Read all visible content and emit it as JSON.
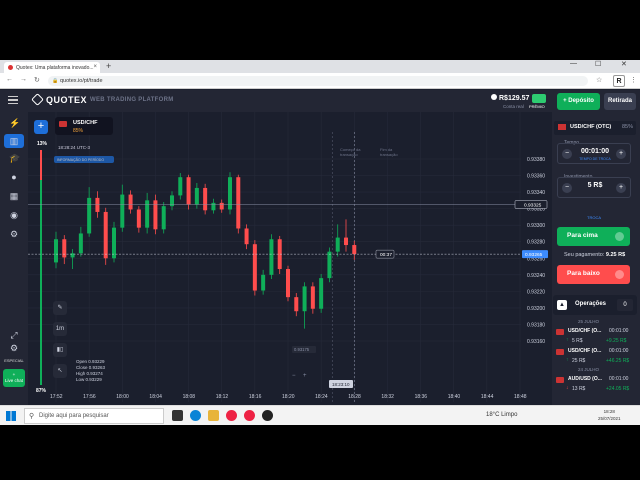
{
  "browser": {
    "tab_title": "Quotex: Uma plataforma inovado...",
    "url": "quotex.io/pt/trade",
    "profile_initial": "R"
  },
  "app": {
    "brand": "QUOTEX",
    "platform_label": "WEB TRADING PLATFORM",
    "balance": "R$129.57",
    "account_type": "Conta real",
    "gift_label": "PRÊMIO",
    "deposit_label": "Depósito",
    "withdraw_label": "Retirada"
  },
  "left_nav": {
    "icons": [
      "menu-icon",
      "lightning-icon",
      "chart-icon",
      "graduation-cap-icon",
      "user-icon",
      "building-icon",
      "signal-icon",
      "settings-icon"
    ],
    "special_label": "ESPECIAL",
    "live_chat_label": "Live chat"
  },
  "chart": {
    "asset": "USD/CHF",
    "asset_payout": "85%",
    "top_percent": "13%",
    "bottom_percent": "87%",
    "clock": "18:28:24",
    "utc": "UTC-3",
    "info_label": "INFORMAÇÃO DO PERÍODO",
    "marker_start_label": "Começo da transação",
    "marker_end_label": "Fim da transação",
    "cursor_price": "0.93325",
    "current_price": "0.93265",
    "timer": "00:37",
    "crosshair_price": "0.93175",
    "crosshair_time": "18:23:10",
    "ohlc": {
      "open": "0.93229",
      "close": "0.93263",
      "high": "0.93274",
      "low": "0.93229"
    },
    "tools": [
      "pencil-icon",
      "1m",
      "candles-icon",
      "cursor-icon"
    ],
    "colors": {
      "up": "#0faf59",
      "down": "#ff4d4d",
      "accent": "#1e6fd9"
    }
  },
  "chart_data": {
    "type": "candlestick",
    "y_ticks": [
      "0.93380",
      "0.93360",
      "0.93340",
      "0.93320",
      "0.93300",
      "0.93280",
      "0.93260",
      "0.93240",
      "0.93220",
      "0.93200",
      "0.93180",
      "0.93160"
    ],
    "x_ticks": [
      "17:52",
      "17:56",
      "18:00",
      "18:04",
      "18:08",
      "18:12",
      "18:16",
      "18:20",
      "18:24",
      "18:28",
      "18:32",
      "18:36",
      "18:40",
      "18:44",
      "18:48"
    ],
    "candles": [
      {
        "t": "17:52",
        "o": 0.93255,
        "c": 0.93283,
        "h": 0.93292,
        "l": 0.93248
      },
      {
        "t": "17:53",
        "o": 0.93283,
        "c": 0.93261,
        "h": 0.93288,
        "l": 0.93253
      },
      {
        "t": "17:54",
        "o": 0.93261,
        "c": 0.93266,
        "h": 0.93271,
        "l": 0.93247
      },
      {
        "t": "17:55",
        "o": 0.93266,
        "c": 0.9329,
        "h": 0.93298,
        "l": 0.93262
      },
      {
        "t": "17:56",
        "o": 0.9329,
        "c": 0.93333,
        "h": 0.93346,
        "l": 0.93286
      },
      {
        "t": "17:57",
        "o": 0.93333,
        "c": 0.93316,
        "h": 0.93341,
        "l": 0.93309
      },
      {
        "t": "17:58",
        "o": 0.93316,
        "c": 0.9326,
        "h": 0.93321,
        "l": 0.93252
      },
      {
        "t": "17:59",
        "o": 0.9326,
        "c": 0.93297,
        "h": 0.93304,
        "l": 0.93255
      },
      {
        "t": "18:00",
        "o": 0.93297,
        "c": 0.93337,
        "h": 0.93349,
        "l": 0.93292
      },
      {
        "t": "18:01",
        "o": 0.93337,
        "c": 0.93319,
        "h": 0.93342,
        "l": 0.93314
      },
      {
        "t": "18:02",
        "o": 0.93319,
        "c": 0.93297,
        "h": 0.93323,
        "l": 0.93291
      },
      {
        "t": "18:03",
        "o": 0.93297,
        "c": 0.9333,
        "h": 0.93339,
        "l": 0.9329
      },
      {
        "t": "18:04",
        "o": 0.9333,
        "c": 0.93295,
        "h": 0.93337,
        "l": 0.93289
      },
      {
        "t": "18:05",
        "o": 0.93295,
        "c": 0.93323,
        "h": 0.93328,
        "l": 0.9329
      },
      {
        "t": "18:06",
        "o": 0.93323,
        "c": 0.93336,
        "h": 0.93341,
        "l": 0.93318
      },
      {
        "t": "18:07",
        "o": 0.93336,
        "c": 0.93358,
        "h": 0.93363,
        "l": 0.93331
      },
      {
        "t": "18:08",
        "o": 0.93358,
        "c": 0.93325,
        "h": 0.93361,
        "l": 0.93319
      },
      {
        "t": "18:09",
        "o": 0.93325,
        "c": 0.93345,
        "h": 0.93351,
        "l": 0.9332
      },
      {
        "t": "18:10",
        "o": 0.93345,
        "c": 0.93318,
        "h": 0.9335,
        "l": 0.93313
      },
      {
        "t": "18:11",
        "o": 0.93318,
        "c": 0.93327,
        "h": 0.93332,
        "l": 0.93314
      },
      {
        "t": "18:12",
        "o": 0.93327,
        "c": 0.93319,
        "h": 0.93331,
        "l": 0.93315
      },
      {
        "t": "18:13",
        "o": 0.93319,
        "c": 0.93358,
        "h": 0.93364,
        "l": 0.93313
      },
      {
        "t": "18:14",
        "o": 0.93358,
        "c": 0.93296,
        "h": 0.93361,
        "l": 0.9329
      },
      {
        "t": "18:15",
        "o": 0.93296,
        "c": 0.93277,
        "h": 0.93301,
        "l": 0.93271
      },
      {
        "t": "18:16",
        "o": 0.93277,
        "c": 0.93221,
        "h": 0.93282,
        "l": 0.93215
      },
      {
        "t": "18:17",
        "o": 0.93221,
        "c": 0.9324,
        "h": 0.93246,
        "l": 0.93216
      },
      {
        "t": "18:18",
        "o": 0.9324,
        "c": 0.93283,
        "h": 0.93289,
        "l": 0.93235
      },
      {
        "t": "18:19",
        "o": 0.93283,
        "c": 0.93247,
        "h": 0.93287,
        "l": 0.93241
      },
      {
        "t": "18:20",
        "o": 0.93247,
        "c": 0.93213,
        "h": 0.93251,
        "l": 0.93208
      },
      {
        "t": "18:21",
        "o": 0.93213,
        "c": 0.93196,
        "h": 0.93218,
        "l": 0.9319
      },
      {
        "t": "18:22",
        "o": 0.93196,
        "c": 0.93226,
        "h": 0.93231,
        "l": 0.93175
      },
      {
        "t": "18:23",
        "o": 0.93226,
        "c": 0.93199,
        "h": 0.93231,
        "l": 0.93193
      },
      {
        "t": "18:24",
        "o": 0.93199,
        "c": 0.93236,
        "h": 0.93241,
        "l": 0.93194
      },
      {
        "t": "18:25",
        "o": 0.93236,
        "c": 0.93268,
        "h": 0.93273,
        "l": 0.93231
      },
      {
        "t": "18:26",
        "o": 0.93268,
        "c": 0.93285,
        "h": 0.93301,
        "l": 0.93262
      },
      {
        "t": "18:27",
        "o": 0.93285,
        "c": 0.93276,
        "h": 0.93307,
        "l": 0.93268
      },
      {
        "t": "18:28",
        "o": 0.93276,
        "c": 0.93265,
        "h": 0.93281,
        "l": 0.93258
      }
    ]
  },
  "trade_panel": {
    "asset": "USD/CHF (OTC)",
    "asset_pct": "85%",
    "time_label": "Tempo",
    "time_value": "00:01:00",
    "time_sub": "TEMPO DE TROCA",
    "invest_label": "Investimento",
    "invest_value": "5 R$",
    "invest_sub": "TROCA",
    "up_label": "Para cima",
    "down_label": "Para baixo",
    "payout_label": "Seu pagamento:",
    "payout_value": "9.25 R$"
  },
  "operations": {
    "label": "Operações",
    "count": "0",
    "groups": [
      {
        "day": "25 JULHO",
        "trades": [
          {
            "asset": "USD/CHF (O...",
            "time": "00:01:00",
            "amount": "5 R$",
            "payout": "+9.25 R$",
            "dir": "up"
          }
        ]
      },
      {
        "day": "",
        "trades": [
          {
            "asset": "USD/CHF (O...",
            "time": "00:01:00",
            "amount": "25 R$",
            "payout": "+46.25 R$",
            "dir": "up"
          }
        ]
      },
      {
        "day": "24 JULHO",
        "trades": [
          {
            "asset": "AUD/USD (O...",
            "time": "00:01:00",
            "amount": "13 R$",
            "payout": "+24.05 R$",
            "dir": "down"
          },
          {
            "asset": "AUD/JPY (O...",
            "time": "00:01:00",
            "amount": "",
            "payout": "",
            "dir": "up"
          }
        ]
      }
    ]
  },
  "taskbar": {
    "search_placeholder": "Digite aqui para pesquisar",
    "weather": "18°C  Limpo",
    "time": "18:28",
    "date": "25/07/2021"
  }
}
